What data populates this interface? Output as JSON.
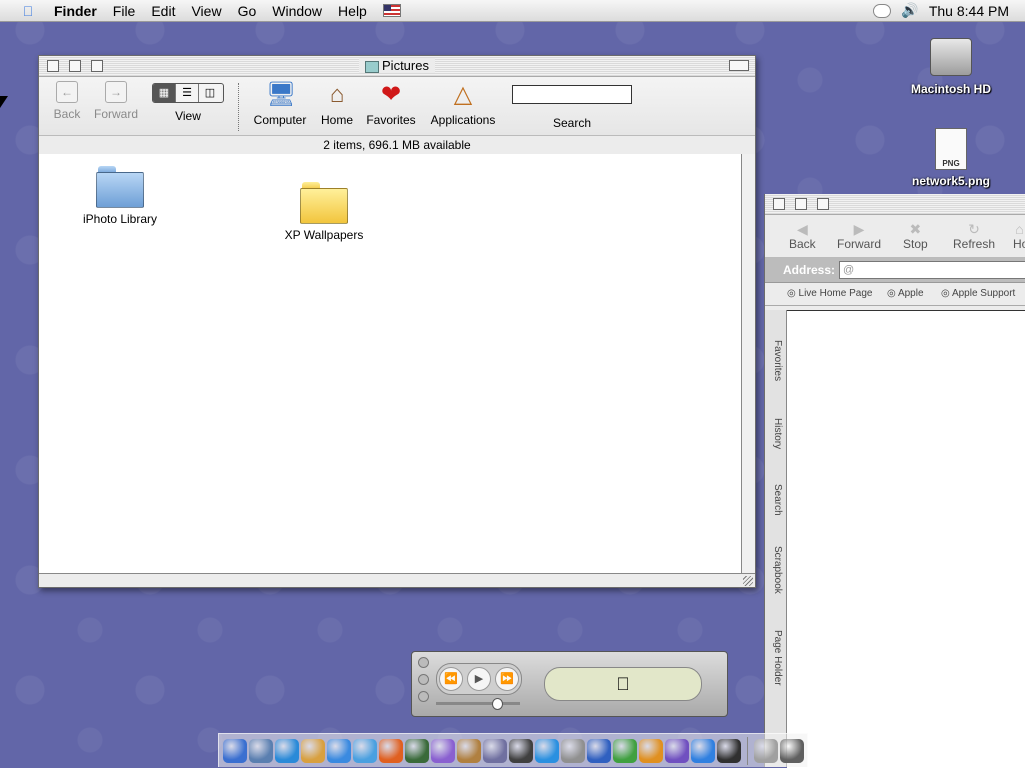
{
  "menubar": {
    "app": "Finder",
    "items": [
      "File",
      "Edit",
      "View",
      "Go",
      "Window",
      "Help"
    ],
    "clock": "Thu 8:44 PM"
  },
  "finder": {
    "title": "Pictures",
    "toolbar": {
      "back": "Back",
      "forward": "Forward",
      "view": "View",
      "computer": "Computer",
      "home": "Home",
      "favorites": "Favorites",
      "applications": "Applications",
      "search": "Search",
      "search_value": ""
    },
    "status": "2 items, 696.1 MB available",
    "files": [
      {
        "name": "iPhoto Library",
        "icon": "blue-folder-icon"
      },
      {
        "name": "XP Wallpapers",
        "icon": "folder-icon"
      }
    ]
  },
  "desktop": {
    "hd": "Macintosh HD",
    "file": "network5.png",
    "file_type": "PNG"
  },
  "browser": {
    "toolbar": {
      "back": "Back",
      "forward": "Forward",
      "stop": "Stop",
      "refresh": "Refresh",
      "home": "Ho"
    },
    "address_label": "Address:",
    "address_value": "@",
    "favorites": [
      "Live Home Page",
      "Apple",
      "Apple Support"
    ],
    "sidetabs": [
      "Favorites",
      "History",
      "Search",
      "Scrapbook",
      "Page Holder"
    ]
  },
  "colors": {
    "desktop": "#6266a8",
    "dock": [
      "#3a6fd0",
      "#5a7fb0",
      "#2a8ad8",
      "#d8a040",
      "#3a8ae0",
      "#4aa0e0",
      "#e06020",
      "#3a6a3a",
      "#8a60d0",
      "#b08040",
      "#7070a0",
      "#404040",
      "#2a90e0",
      "#909090",
      "#3060c0",
      "#40a040",
      "#e09020",
      "#7050c0",
      "#3080e0",
      "#303030",
      "#a0a0a0",
      "#606060"
    ]
  }
}
